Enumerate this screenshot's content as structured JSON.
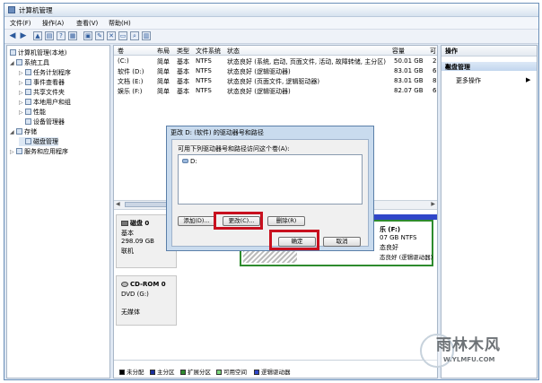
{
  "window": {
    "title": "计算机管理"
  },
  "menu": [
    "文件(F)",
    "操作(A)",
    "查看(V)",
    "帮助(H)"
  ],
  "tree": {
    "root": "计算机管理(本地)",
    "items": [
      {
        "label": "系统工具",
        "level": 1,
        "expander": "◢"
      },
      {
        "label": "任务计划程序",
        "level": 2,
        "expander": "▷"
      },
      {
        "label": "事件查看器",
        "level": 2,
        "expander": "▷"
      },
      {
        "label": "共享文件夹",
        "level": 2,
        "expander": "▷"
      },
      {
        "label": "本地用户和组",
        "level": 2,
        "expander": "▷"
      },
      {
        "label": "性能",
        "level": 2,
        "expander": "▷"
      },
      {
        "label": "设备管理器",
        "level": 2,
        "expander": ""
      },
      {
        "label": "存储",
        "level": 1,
        "expander": "◢"
      },
      {
        "label": "磁盘管理",
        "level": 2,
        "expander": ""
      },
      {
        "label": "服务和应用程序",
        "level": 1,
        "expander": "▷"
      }
    ]
  },
  "volumes": {
    "headers": [
      "卷",
      "布局",
      "类型",
      "文件系统",
      "状态",
      "容量",
      "可"
    ],
    "rows": [
      [
        "(C:)",
        "简单",
        "基本",
        "NTFS",
        "状态良好 (系统, 启动, 页面文件, 活动, 故障转储, 主分区)",
        "50.01 GB",
        "2"
      ],
      [
        "软件 (D:)",
        "简单",
        "基本",
        "NTFS",
        "状态良好 (逻辑驱动器)",
        "83.01 GB",
        "6"
      ],
      [
        "文档 (E:)",
        "简单",
        "基本",
        "NTFS",
        "状态良好 (页面文件, 逻辑驱动器)",
        "83.01 GB",
        "8"
      ],
      [
        "娱乐 (F:)",
        "简单",
        "基本",
        "NTFS",
        "状态良好 (逻辑驱动器)",
        "82.07 GB",
        "6"
      ]
    ]
  },
  "disks": [
    {
      "name": "磁盘 0",
      "type": "基本",
      "size": "298.09 GB",
      "status": "联机"
    },
    {
      "name": "CD-ROM 0",
      "type": "DVD (G:)",
      "size": "",
      "status": "无媒体"
    }
  ],
  "partition_f": {
    "label": "乐 (F:)",
    "size": "07 GB NTFS",
    "status1": "态良好",
    "status2": "态良好 (逻辑驱动器)"
  },
  "legend": [
    {
      "label": "未分配",
      "color": "#000000"
    },
    {
      "label": "主分区",
      "color": "#1a2f9e"
    },
    {
      "label": "扩展分区",
      "color": "#2e8b2e"
    },
    {
      "label": "可用空间",
      "color": "#7ed67e"
    },
    {
      "label": "逻辑驱动器",
      "color": "#2f46c9"
    }
  ],
  "actions": {
    "header": "操作",
    "selected": "磁盘管理",
    "more": "更多操作"
  },
  "dialog": {
    "title": "更改 D: (软件) 的驱动器号和路径",
    "label": "可用下列驱动器号和路径访问这个卷(A):",
    "item": "D:",
    "add": "添加(D)...",
    "change": "更改(C)...",
    "delete": "删除(R)",
    "ok": "确定",
    "cancel": "取消"
  },
  "watermark": {
    "brand": "雨林木风",
    "url": "W.YLMFU.COM"
  },
  "colors": {
    "highlight": "#c8101e",
    "selection": "#c2d6ee"
  }
}
